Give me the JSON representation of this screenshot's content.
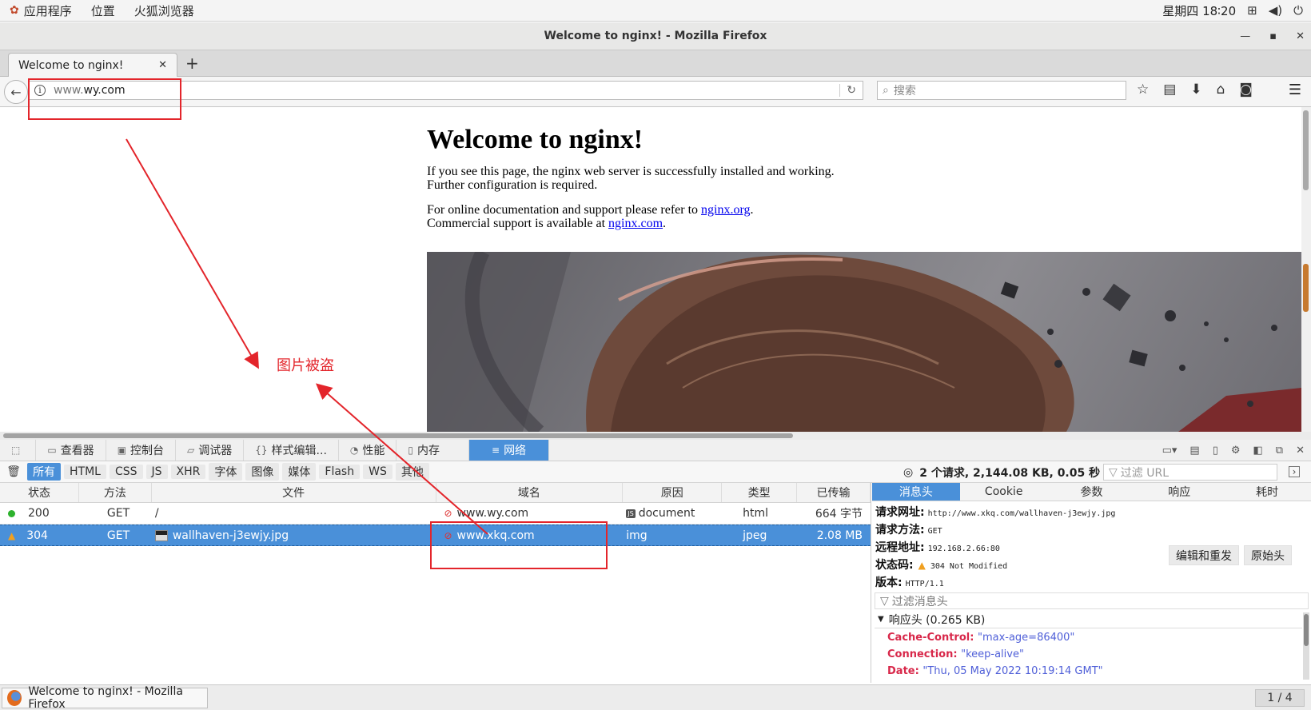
{
  "topbar": {
    "applications": "应用程序",
    "places": "位置",
    "firefox": "火狐浏览器",
    "clock": "星期四 18∶20"
  },
  "window": {
    "title": "Welcome to nginx! - Mozilla Firefox"
  },
  "browser": {
    "tab_title": "Welcome to nginx!",
    "url_prefix": "www.",
    "url_host": "wy.com",
    "search_placeholder": "搜索"
  },
  "page": {
    "heading": "Welcome to nginx!",
    "p1_line1": "If you see this page, the nginx web server is successfully installed and working.",
    "p1_line2": "Further configuration is required.",
    "p2_line1_pre": "For online documentation and support please refer to ",
    "p2_link1": "nginx.org",
    "p2_line1_post": ".",
    "p2_line2_pre": "Commercial support is available at ",
    "p2_link2": "nginx.com",
    "p2_line2_post": "."
  },
  "annotation": {
    "label": "图片被盗",
    "color": "#e3252b"
  },
  "devtools": {
    "tabs": [
      "查看器",
      "控制台",
      "调试器",
      "样式编辑...",
      "性能",
      "内存",
      "网络"
    ],
    "filters": [
      "所有",
      "HTML",
      "CSS",
      "JS",
      "XHR",
      "字体",
      "图像",
      "媒体",
      "Flash",
      "WS",
      "其他"
    ],
    "summary": "2 个请求, 2,144.08 KB, 0.05 秒",
    "filter_url_placeholder": "过滤 URL",
    "columns": [
      "状态",
      "方法",
      "文件",
      "域名",
      "原因",
      "类型",
      "已传输"
    ],
    "requests": [
      {
        "status": "200",
        "method": "GET",
        "file": "/",
        "domain": "www.wy.com",
        "cause": "document",
        "type": "html",
        "size": "664 字节"
      },
      {
        "status": "304",
        "method": "GET",
        "file": "wallhaven-j3ewjy.jpg",
        "domain": "www.xkq.com",
        "cause": "img",
        "type": "jpeg",
        "size": "2.08 MB"
      }
    ],
    "detail_tabs": [
      "消息头",
      "Cookie",
      "参数",
      "响应",
      "耗时"
    ],
    "details": {
      "url_label": "请求网址:",
      "url": "http://www.xkq.com/wallhaven-j3ewjy.jpg",
      "method_label": "请求方法:",
      "method": "GET",
      "remote_label": "远程地址:",
      "remote": "192.168.2.66:80",
      "status_label": "状态码:",
      "status": "304 Not Modified",
      "version_label": "版本:",
      "version": "HTTP/1.1",
      "edit_resend": "编辑和重发",
      "raw_headers": "原始头",
      "filter_headers_placeholder": "过滤消息头",
      "response_headers": "响应头 (0.265 KB)",
      "headers": [
        {
          "key": "Cache-Control",
          "value": "\"max-age=86400\""
        },
        {
          "key": "Connection",
          "value": "\"keep-alive\""
        },
        {
          "key": "Date",
          "value": "\"Thu, 05 May 2022 10:19:14 GMT\""
        }
      ]
    }
  },
  "taskbar": {
    "item": "Welcome to nginx! - Mozilla Firefox",
    "pager": "1 / 4"
  }
}
